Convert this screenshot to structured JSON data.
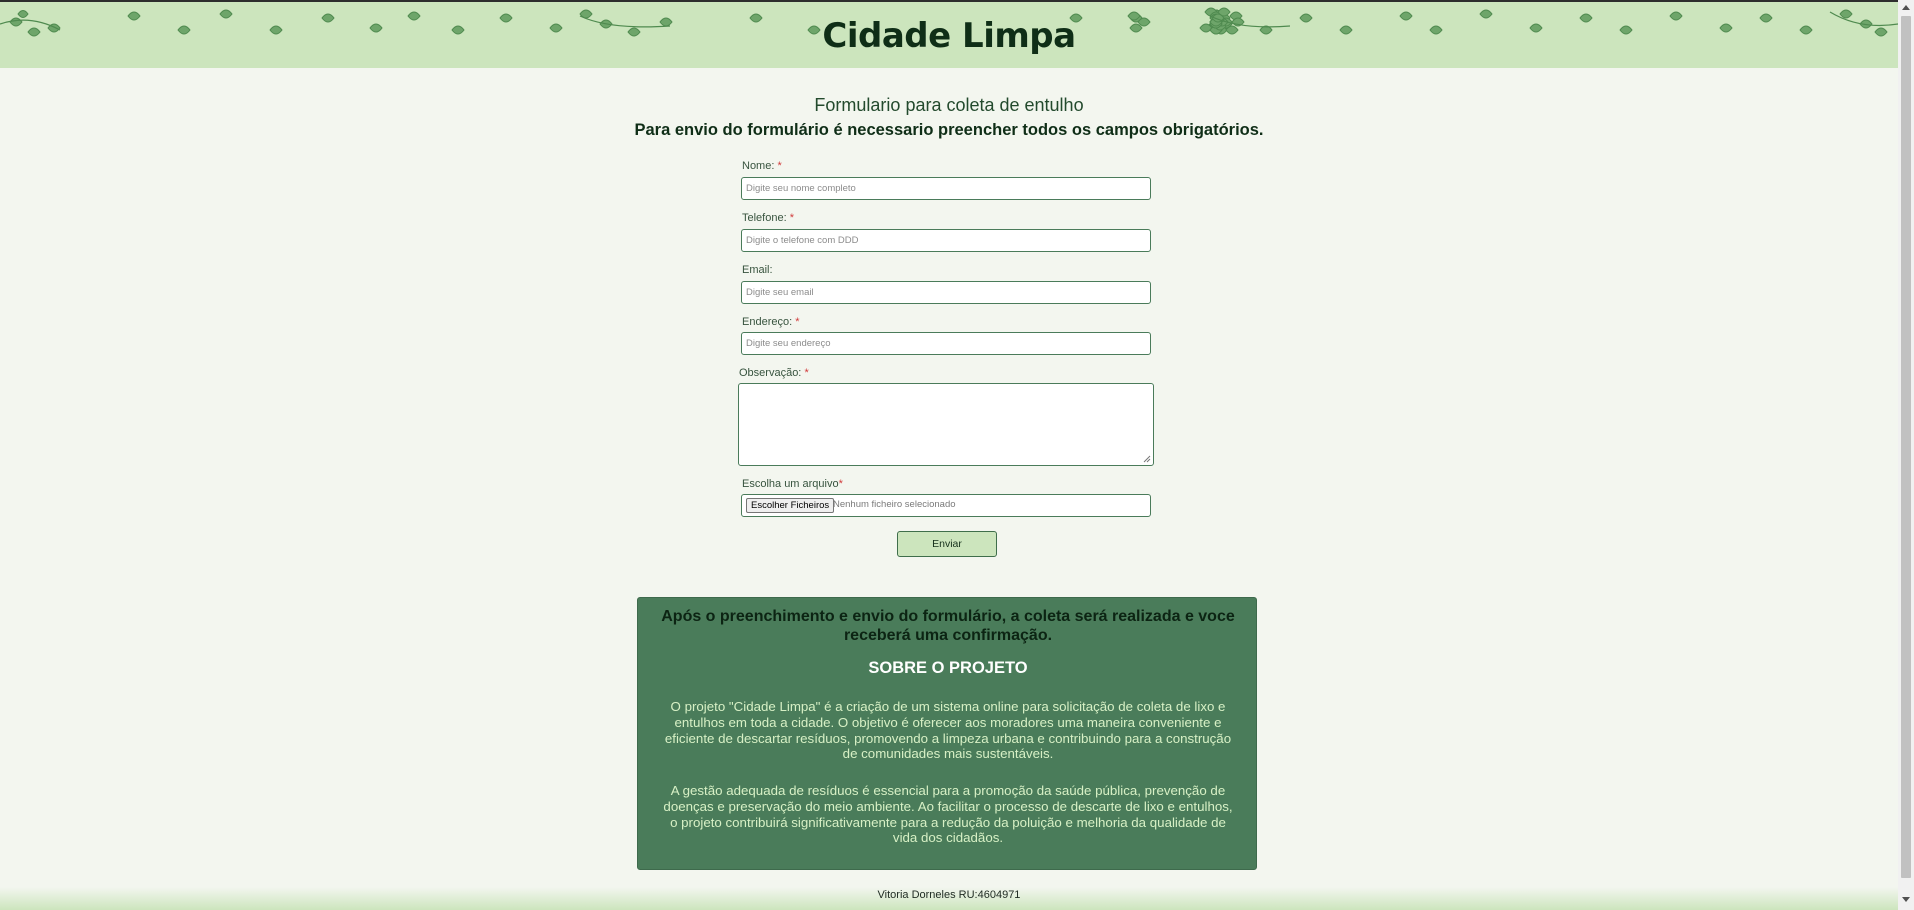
{
  "header": {
    "title": "Cidade Limpa",
    "background_color": "#cce5bd",
    "decoration": "ivy-leaves"
  },
  "form": {
    "heading": "Formulario para coleta de entulho",
    "notice": "Para envio do formulário é necessario preencher todos os campos obrigatórios.",
    "required_marker": "*",
    "fields": {
      "name": {
        "label": "Nome:",
        "placeholder": "Digite seu nome completo",
        "required": true
      },
      "phone": {
        "label": "Telefone:",
        "placeholder": "Digite o telefone com DDD",
        "required": true
      },
      "email": {
        "label": "Email:",
        "placeholder": "Digite seu email",
        "required": false
      },
      "address": {
        "label": "Endereço:",
        "placeholder": "Digite seu endereço",
        "required": true
      },
      "notes": {
        "label": "Observação:",
        "required": true
      },
      "file": {
        "label": "Escolha um arquivo",
        "button_label": "Escolher Ficheiros",
        "status": "Nenhum ficheiro selecionado",
        "required": true
      }
    },
    "submit_label": "Enviar"
  },
  "info": {
    "confirmation": "Após o preenchimento e envio do formulário, a coleta será realizada e voce receberá uma confirmação.",
    "title": "SOBRE O PROJETO",
    "paragraph1": "O projeto \"Cidade Limpa\" é a criação de um sistema online para solicitação de coleta de lixo e entulhos em toda a cidade. O objetivo é oferecer aos moradores uma maneira conveniente e eficiente de descartar resíduos, promovendo a limpeza urbana e contribuindo para a construção de comunidades mais sustentáveis.",
    "paragraph2": "A gestão adequada de resíduos é essencial para a promoção da saúde pública, prevenção de doenças e preservação do meio ambiente. Ao facilitar o processo de descarte de lixo e entulhos, o projeto contribuirá significativamente para a redução da poluição e melhoria da qualidade de vida dos cidadãos.",
    "background_color": "#4a7c5a"
  },
  "footer": {
    "credit": "Vitoria Dorneles RU:4604971"
  }
}
